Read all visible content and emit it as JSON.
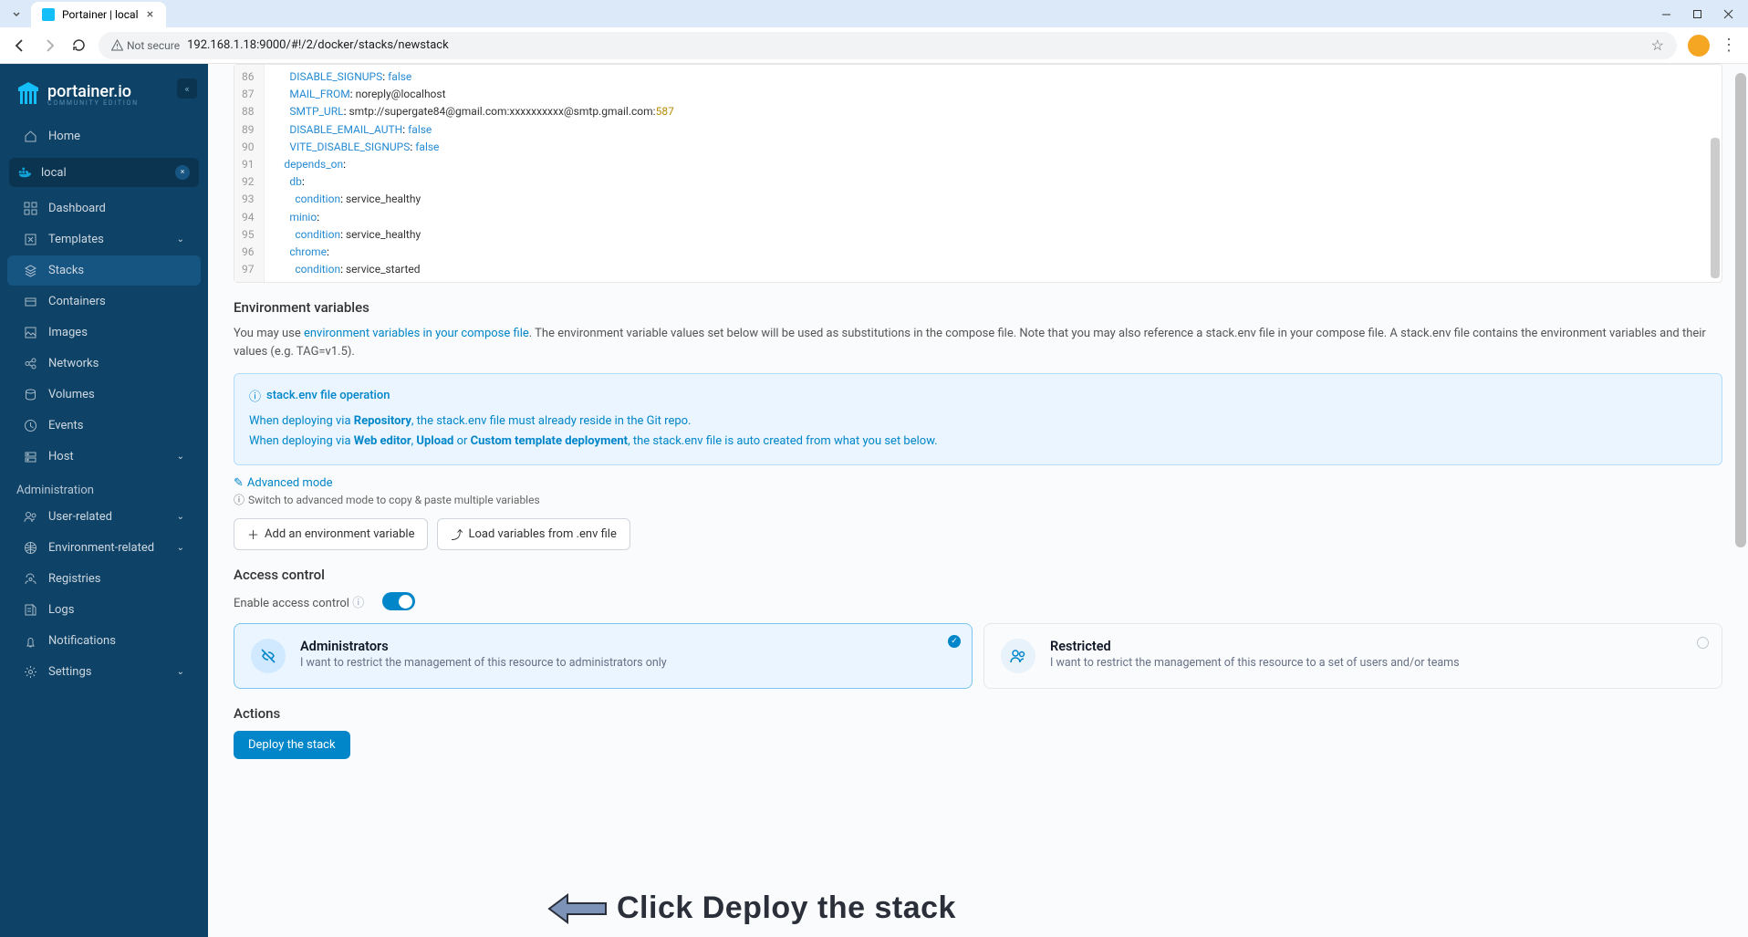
{
  "browser": {
    "tab_title": "Portainer | local",
    "not_secure": "Not secure",
    "url": "192.168.1.18:9000/#!/2/docker/stacks/newstack"
  },
  "sidebar": {
    "brand": "portainer.io",
    "brand_sub": "COMMUNITY EDITION",
    "home": "Home",
    "env_label": "local",
    "items": [
      {
        "label": "Dashboard"
      },
      {
        "label": "Templates"
      },
      {
        "label": "Stacks"
      },
      {
        "label": "Containers"
      },
      {
        "label": "Images"
      },
      {
        "label": "Networks"
      },
      {
        "label": "Volumes"
      },
      {
        "label": "Events"
      },
      {
        "label": "Host"
      }
    ],
    "admin_header": "Administration",
    "admin_items": [
      {
        "label": "User-related"
      },
      {
        "label": "Environment-related"
      },
      {
        "label": "Registries"
      },
      {
        "label": "Logs"
      },
      {
        "label": "Notifications"
      },
      {
        "label": "Settings"
      }
    ]
  },
  "editor": {
    "lines": [
      {
        "n": 86,
        "indent": 3,
        "key": "DISABLE_SIGNUPS",
        "val": "false",
        "valtype": "bool"
      },
      {
        "n": 87,
        "indent": 3,
        "key": "MAIL_FROM",
        "val": "noreply@localhost",
        "valtype": "str"
      },
      {
        "n": 88,
        "indent": 3,
        "key": "SMTP_URL",
        "val": "smtp://supergate84@gmail.com:xxxxxxxxxx@smtp.gmail.com:",
        "num": "587",
        "valtype": "str"
      },
      {
        "n": 89,
        "indent": 3,
        "key": "DISABLE_EMAIL_AUTH",
        "val": "false",
        "valtype": "bool"
      },
      {
        "n": 90,
        "indent": 3,
        "key": "VITE_DISABLE_SIGNUPS",
        "val": "false",
        "valtype": "bool"
      },
      {
        "n": 91,
        "indent": 2,
        "key": "depends_on",
        "val": "",
        "valtype": "none"
      },
      {
        "n": 92,
        "indent": 3,
        "key": "db",
        "val": "",
        "valtype": "none"
      },
      {
        "n": 93,
        "indent": 4,
        "key": "condition",
        "val": "service_healthy",
        "valtype": "str"
      },
      {
        "n": 94,
        "indent": 3,
        "key": "minio",
        "val": "",
        "valtype": "none"
      },
      {
        "n": 95,
        "indent": 4,
        "key": "condition",
        "val": "service_healthy",
        "valtype": "str"
      },
      {
        "n": 96,
        "indent": 3,
        "key": "chrome",
        "val": "",
        "valtype": "none"
      },
      {
        "n": 97,
        "indent": 4,
        "key": "condition",
        "val": "service_started",
        "valtype": "str"
      }
    ]
  },
  "env": {
    "title": "Environment variables",
    "desc_pre": "You may use ",
    "desc_link": "environment variables in your compose file",
    "desc_post": ". The environment variable values set below will be used as substitutions in the compose file. Note that you may also reference a stack.env file in your compose file. A stack.env file contains the environment variables and their values (e.g. TAG=v1.5).",
    "info_title": "stack.env file operation",
    "info_l1_a": "When deploying via ",
    "info_l1_b": "Repository",
    "info_l1_c": ", the stack.env file must already reside in the Git repo.",
    "info_l2_a": "When deploying via ",
    "info_l2_b": "Web editor",
    "info_l2_c": ", ",
    "info_l2_d": "Upload",
    "info_l2_e": " or ",
    "info_l2_f": "Custom template deployment",
    "info_l2_g": ", the stack.env file is auto created from what you set below.",
    "adv_link": "Advanced mode",
    "adv_sub": "Switch to advanced mode to copy & paste multiple variables",
    "add_btn": "Add an environment variable",
    "load_btn": "Load variables from .env file"
  },
  "access": {
    "title": "Access control",
    "toggle_label": "Enable access control",
    "cards": [
      {
        "title": "Administrators",
        "desc": "I want to restrict the management of this resource to administrators only"
      },
      {
        "title": "Restricted",
        "desc": "I want to restrict the management of this resource to a set of users and/or teams"
      }
    ]
  },
  "actions": {
    "title": "Actions",
    "deploy": "Deploy the stack"
  },
  "annotation": "Click Deploy the stack"
}
